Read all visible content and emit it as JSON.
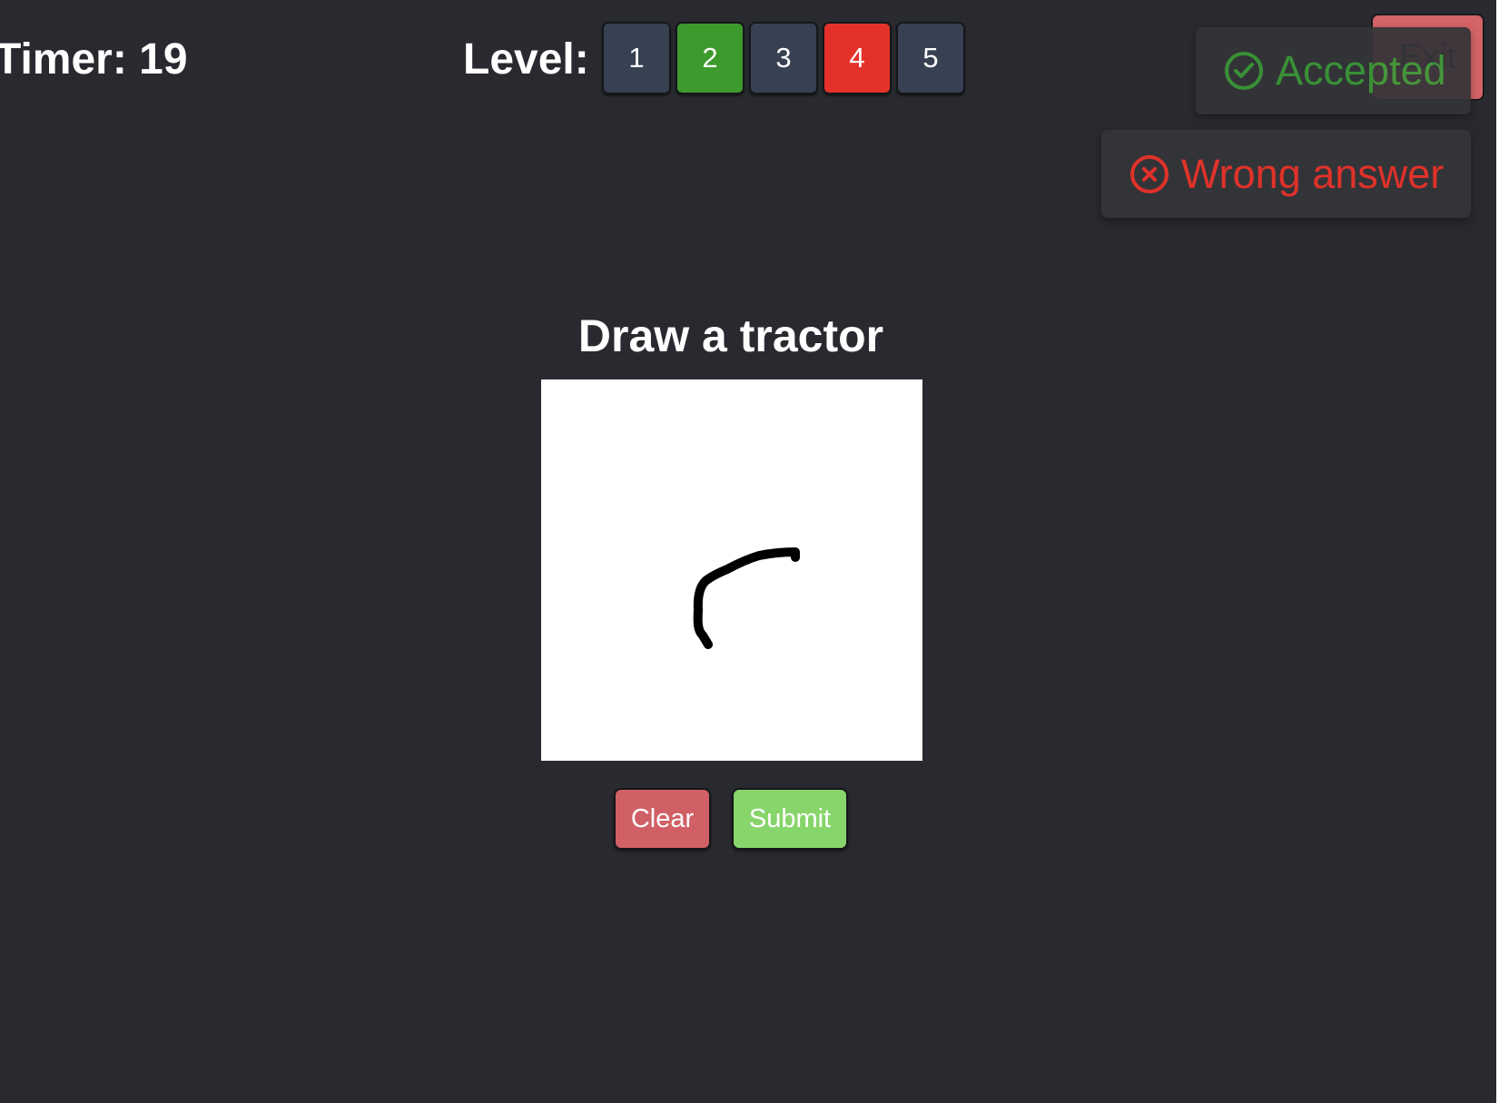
{
  "timer": {
    "label": "Timer: 19"
  },
  "level": {
    "label": "Level:",
    "buttons": [
      {
        "label": "1",
        "state": "default",
        "color": "#374152"
      },
      {
        "label": "2",
        "state": "passed",
        "color": "#3d9a2d"
      },
      {
        "label": "3",
        "state": "default",
        "color": "#374152"
      },
      {
        "label": "4",
        "state": "current",
        "color": "#e4322a"
      },
      {
        "label": "5",
        "state": "default",
        "color": "#374152"
      }
    ]
  },
  "exit_button": {
    "label": "Exit"
  },
  "toasts": {
    "accepted": {
      "label": "Accepted",
      "icon": "check-circle-icon",
      "color": "#3b9a37"
    },
    "wrong": {
      "label": "Wrong answer",
      "icon": "x-circle-icon",
      "color": "#e0322a"
    }
  },
  "prompt": {
    "text": "Draw a tractor"
  },
  "actions": {
    "clear_label": "Clear",
    "submit_label": "Submit"
  },
  "colors": {
    "background": "#292a2f",
    "canvas": "#ffffff",
    "stroke": "#000000",
    "clear": "#d06065",
    "submit": "#88d56b"
  }
}
